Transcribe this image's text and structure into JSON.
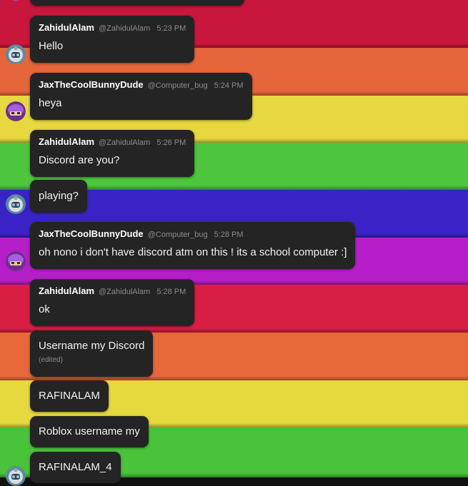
{
  "background": {
    "stripe_colors": [
      "#c8163c",
      "#e6653a",
      "#e6d83e",
      "#4dc53c",
      "#3a23c6",
      "#b51ec8",
      "#d81e42",
      "#e8683a",
      "#e6d93e",
      "#49c43a"
    ]
  },
  "messages": [
    {
      "author": "ZahidulAlam",
      "handle": "@ZahidulAlam",
      "time": "5:23 PM",
      "text": "Hello",
      "avatar": "robot-avatar-icon"
    },
    {
      "author": "JaxTheCoolBunnyDude",
      "handle": "@Computer_bug",
      "time": "5:24 PM",
      "text": "heya",
      "avatar": "purple-avatar-icon"
    },
    {
      "author": "ZahidulAlam",
      "handle": "@ZahidulAlam",
      "time": "5:26 PM",
      "text": "Discord are you?"
    },
    {
      "text": "playing?",
      "avatar": "robot-avatar-icon"
    },
    {
      "author": "JaxTheCoolBunnyDude",
      "handle": "@Computer_bug",
      "time": "5:28 PM",
      "text": "oh nono i don't have discord atm on this ! its a school computer :]",
      "avatar": "purple-avatar-icon"
    },
    {
      "author": "ZahidulAlam",
      "handle": "@ZahidulAlam",
      "time": "5:28 PM",
      "text": "ok"
    },
    {
      "text": "Username my Discord",
      "edited": "(edited)"
    },
    {
      "text": "RAFINALAM"
    },
    {
      "text": "Roblox username my"
    },
    {
      "text": "RAFINALAM_4",
      "avatar": "robot-avatar-icon"
    }
  ]
}
